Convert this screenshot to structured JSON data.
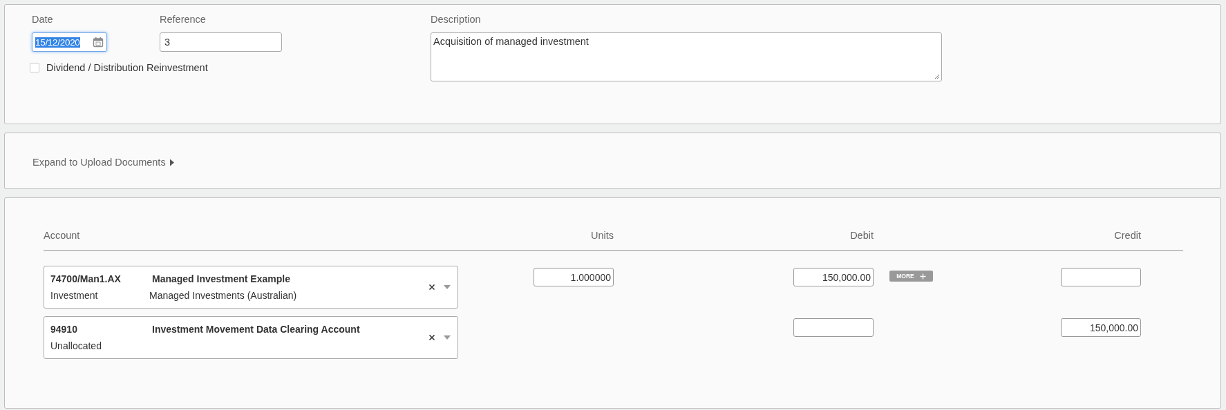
{
  "details": {
    "date": {
      "label": "Date",
      "value": "15/12/2020",
      "focused": true
    },
    "reference": {
      "label": "Reference",
      "value": "3"
    },
    "description": {
      "label": "Description",
      "value": "Acquisition of managed investment"
    },
    "reinvestment": {
      "label": "Dividend / Distribution Reinvestment",
      "checked": false
    }
  },
  "documents": {
    "label": "Expand to Upload Documents",
    "expanded": false
  },
  "journal": {
    "columns": [
      "Account",
      "Units",
      "Debit",
      "Credit"
    ],
    "rows": [
      {
        "code": "74700/Man1.AX",
        "name": "Managed Investment Example",
        "type": "Investment",
        "category": "Managed Investments (Australian)",
        "units": "1.000000",
        "debit": "150,000.00",
        "more": "MORE"
      },
      {
        "code": "94910",
        "name": "Investment Movement Data Clearing Account",
        "type": "Unallocated",
        "credit": "150,000.00"
      }
    ]
  }
}
